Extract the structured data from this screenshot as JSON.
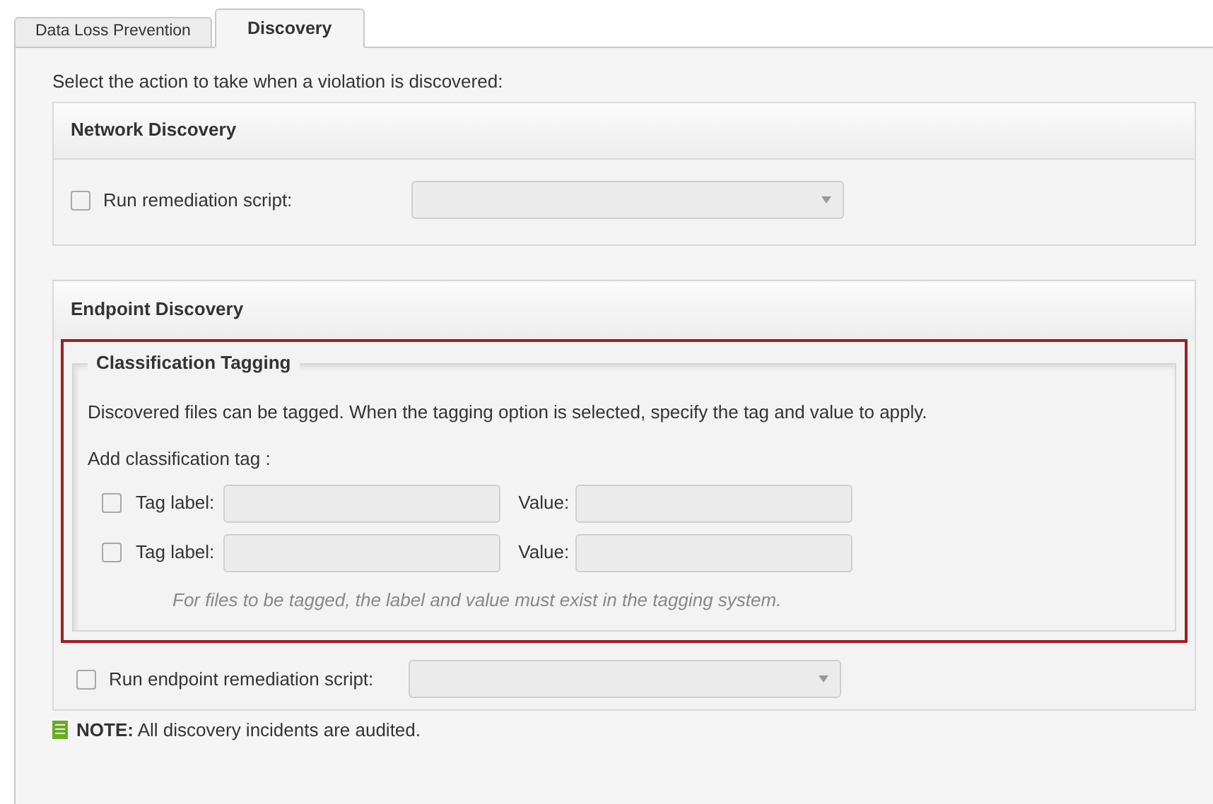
{
  "tabs": [
    {
      "label": "Data Loss Prevention",
      "selected": false
    },
    {
      "label": "Discovery",
      "selected": true
    }
  ],
  "intro": "Select the action to take when a violation is discovered:",
  "network_discovery": {
    "title": "Network Discovery",
    "checkbox": {
      "label": "Run remediation script:",
      "checked": false
    }
  },
  "endpoint_discovery": {
    "title": "Endpoint Discovery",
    "classification_tagging": {
      "title": "Classification Tagging",
      "description": "Discovered files can be tagged. When the tagging option is selected, specify the tag and value to apply.",
      "add_label": "Add classification tag :",
      "rows": [
        {
          "checked": false,
          "tag_label": "Tag label:",
          "value_label": "Value:"
        },
        {
          "checked": false,
          "tag_label": "Tag label:",
          "value_label": "Value:"
        }
      ],
      "hint": "For files to be tagged, the label and value must exist in the tagging system."
    },
    "checkbox": {
      "label": "Run endpoint remediation script:",
      "checked": false
    }
  },
  "note": "**NOTE:** All discovery incidents are audited."
}
